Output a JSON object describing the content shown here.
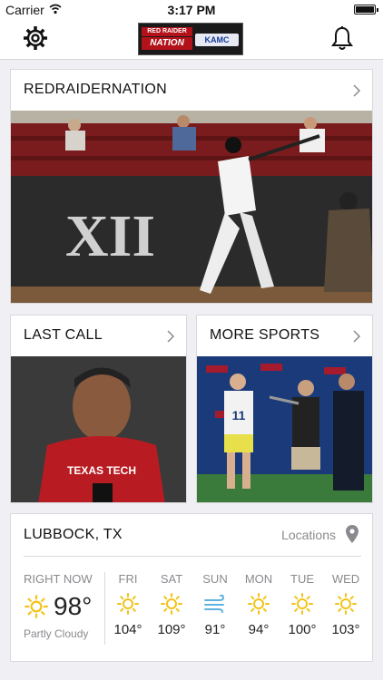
{
  "status_bar": {
    "carrier": "Carrier",
    "time": "3:17 PM"
  },
  "header": {
    "logo_text": {
      "top": "RED RAIDER",
      "main": "NATION",
      "station": "KAMC"
    }
  },
  "cards": {
    "main": {
      "title": "REDRAIDERNATION"
    },
    "left": {
      "title": "LAST CALL"
    },
    "right": {
      "title": "MORE SPORTS"
    }
  },
  "weather": {
    "city": "LUBBOCK, TX",
    "locations_label": "Locations",
    "now": {
      "label": "RIGHT NOW",
      "temp": "98°",
      "condition": "Partly Cloudy",
      "icon": "sun-icon"
    },
    "forecast": [
      {
        "day": "FRI",
        "temp": "104°",
        "icon": "sun-icon"
      },
      {
        "day": "SAT",
        "temp": "109°",
        "icon": "sun-icon"
      },
      {
        "day": "SUN",
        "temp": "91°",
        "icon": "wind-icon"
      },
      {
        "day": "MON",
        "temp": "94°",
        "icon": "sun-icon"
      },
      {
        "day": "TUE",
        "temp": "100°",
        "icon": "sun-icon"
      },
      {
        "day": "WED",
        "temp": "103°",
        "icon": "sun-icon"
      }
    ]
  },
  "colors": {
    "sun": "#f2c316",
    "wind": "#5fb3de",
    "brand_red": "#b3121a"
  }
}
